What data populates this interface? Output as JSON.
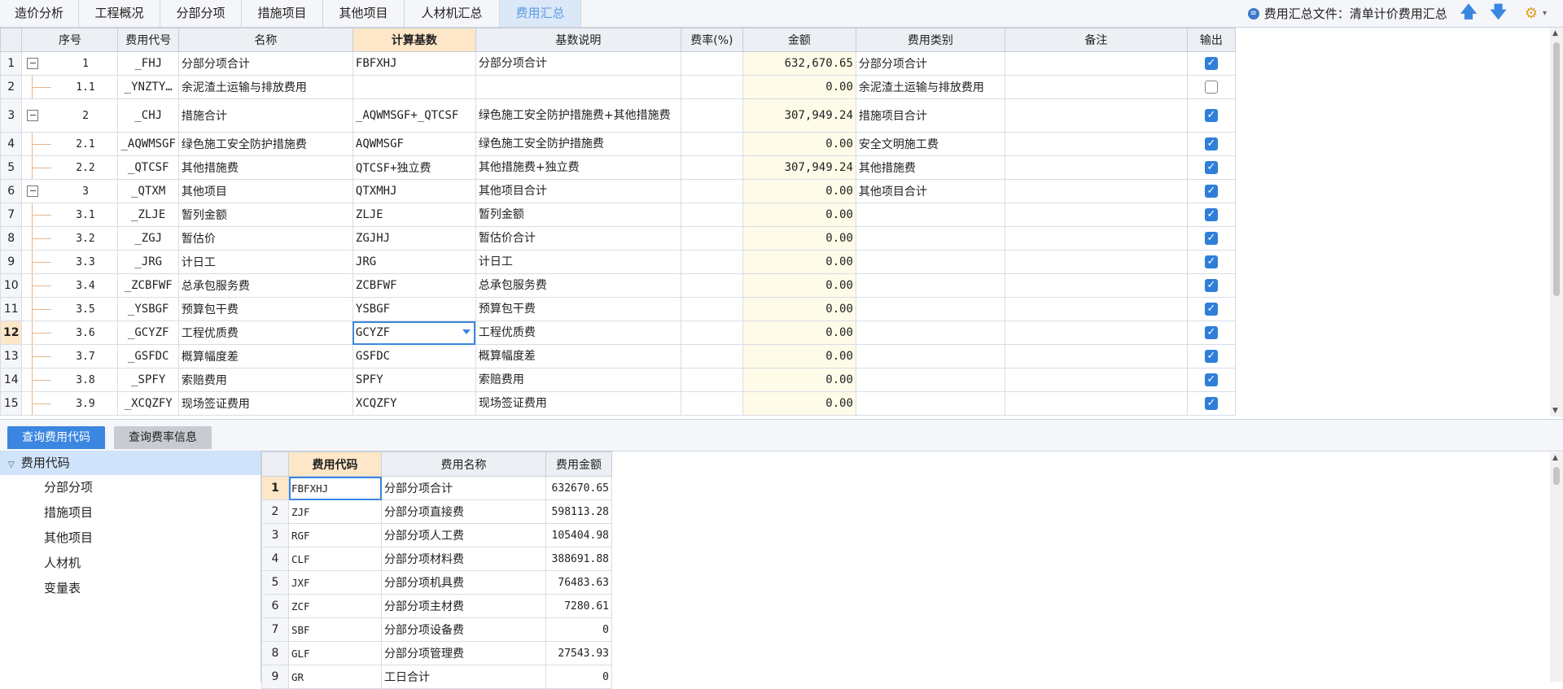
{
  "tabs": [
    "造价分析",
    "工程概况",
    "分部分项",
    "措施项目",
    "其他项目",
    "人材机汇总",
    "费用汇总"
  ],
  "active_tab": "费用汇总",
  "fee_file_label": "费用汇总文件：清单计价费用汇总",
  "grid": {
    "headers": [
      "序号",
      "费用代号",
      "名称",
      "计算基数",
      "基数说明",
      "费率(%)",
      "金额",
      "费用类别",
      "备注",
      "输出"
    ],
    "rows": [
      {
        "rn": "1",
        "seq": "1",
        "code": "_FHJ",
        "name": "分部分项合计",
        "base": "FBFXHJ",
        "desc": "分部分项合计",
        "rate": "",
        "amount": "632,670.65",
        "category": "分部分项合计",
        "note": "",
        "output": true
      },
      {
        "rn": "2",
        "seq": "1.1",
        "code": "_YNZTY…",
        "name": "余泥渣土运输与排放费用",
        "base": "",
        "desc": "",
        "rate": "",
        "amount": "0.00",
        "category": "余泥渣土运输与排放费用",
        "note": "",
        "output": false
      },
      {
        "rn": "3",
        "seq": "2",
        "code": "_CHJ",
        "name": "措施合计",
        "base": "_AQWMSGF+_QTCSF",
        "desc": "绿色施工安全防护措施费+其他措施费",
        "rate": "",
        "amount": "307,949.24",
        "category": "措施项目合计",
        "note": "",
        "output": true
      },
      {
        "rn": "4",
        "seq": "2.1",
        "code": "_AQWMSGF",
        "name": "绿色施工安全防护措施费",
        "base": "AQWMSGF",
        "desc": "绿色施工安全防护措施费",
        "rate": "",
        "amount": "0.00",
        "category": "安全文明施工费",
        "note": "",
        "output": true
      },
      {
        "rn": "5",
        "seq": "2.2",
        "code": "_QTCSF",
        "name": "其他措施费",
        "base": "QTCSF+独立费",
        "desc": "其他措施费+独立费",
        "rate": "",
        "amount": "307,949.24",
        "category": "其他措施费",
        "note": "",
        "output": true
      },
      {
        "rn": "6",
        "seq": "3",
        "code": "_QTXM",
        "name": "其他项目",
        "base": "QTXMHJ",
        "desc": "其他项目合计",
        "rate": "",
        "amount": "0.00",
        "category": "其他项目合计",
        "note": "",
        "output": true
      },
      {
        "rn": "7",
        "seq": "3.1",
        "code": "_ZLJE",
        "name": "暂列金额",
        "base": "ZLJE",
        "desc": "暂列金额",
        "rate": "",
        "amount": "0.00",
        "category": "",
        "note": "",
        "output": true
      },
      {
        "rn": "8",
        "seq": "3.2",
        "code": "_ZGJ",
        "name": "暂估价",
        "base": "ZGJHJ",
        "desc": "暂估价合计",
        "rate": "",
        "amount": "0.00",
        "category": "",
        "note": "",
        "output": true
      },
      {
        "rn": "9",
        "seq": "3.3",
        "code": "_JRG",
        "name": "计日工",
        "base": "JRG",
        "desc": "计日工",
        "rate": "",
        "amount": "0.00",
        "category": "",
        "note": "",
        "output": true
      },
      {
        "rn": "10",
        "seq": "3.4",
        "code": "_ZCBFWF",
        "name": "总承包服务费",
        "base": "ZCBFWF",
        "desc": "总承包服务费",
        "rate": "",
        "amount": "0.00",
        "category": "",
        "note": "",
        "output": true
      },
      {
        "rn": "11",
        "seq": "3.5",
        "code": "_YSBGF",
        "name": "预算包干费",
        "base": "YSBGF",
        "desc": "预算包干费",
        "rate": "",
        "amount": "0.00",
        "category": "",
        "note": "",
        "output": true
      },
      {
        "rn": "12",
        "seq": "3.6",
        "code": "_GCYZF",
        "name": "工程优质费",
        "base": "GCYZF",
        "desc": "工程优质费",
        "rate": "",
        "amount": "0.00",
        "category": "",
        "note": "",
        "output": true
      },
      {
        "rn": "13",
        "seq": "3.7",
        "code": "_GSFDC",
        "name": "概算幅度差",
        "base": "GSFDC",
        "desc": "概算幅度差",
        "rate": "",
        "amount": "0.00",
        "category": "",
        "note": "",
        "output": true
      },
      {
        "rn": "14",
        "seq": "3.8",
        "code": "_SPFY",
        "name": "索赔费用",
        "base": "SPFY",
        "desc": "索赔费用",
        "rate": "",
        "amount": "0.00",
        "category": "",
        "note": "",
        "output": true
      },
      {
        "rn": "15",
        "seq": "3.9",
        "code": "_XCQZFY",
        "name": "现场签证费用",
        "base": "XCQZFY",
        "desc": "现场签证费用",
        "rate": "",
        "amount": "0.00",
        "category": "",
        "note": "",
        "output": true
      }
    ]
  },
  "bottom_tabs": [
    "查询费用代码",
    "查询费率信息"
  ],
  "tree": {
    "root": "费用代码",
    "items": [
      "分部分项",
      "措施项目",
      "其他项目",
      "人材机",
      "变量表"
    ]
  },
  "sub": {
    "headers": [
      "费用代码",
      "费用名称",
      "费用金额"
    ],
    "rows": [
      {
        "rn": "1",
        "code": "FBFXHJ",
        "name": "分部分项合计",
        "amount": "632670.65"
      },
      {
        "rn": "2",
        "code": "ZJF",
        "name": "分部分项直接费",
        "amount": "598113.28"
      },
      {
        "rn": "3",
        "code": "RGF",
        "name": "分部分项人工费",
        "amount": "105404.98"
      },
      {
        "rn": "4",
        "code": "CLF",
        "name": "分部分项材料费",
        "amount": "388691.88"
      },
      {
        "rn": "5",
        "code": "JXF",
        "name": "分部分项机具费",
        "amount": "76483.63"
      },
      {
        "rn": "6",
        "code": "ZCF",
        "name": "分部分项主材费",
        "amount": "7280.61"
      },
      {
        "rn": "7",
        "code": "SBF",
        "name": "分部分项设备费",
        "amount": "0"
      },
      {
        "rn": "8",
        "code": "GLF",
        "name": "分部分项管理费",
        "amount": "27543.93"
      },
      {
        "rn": "9",
        "code": "GR",
        "name": "工日合计",
        "amount": "0"
      }
    ]
  }
}
